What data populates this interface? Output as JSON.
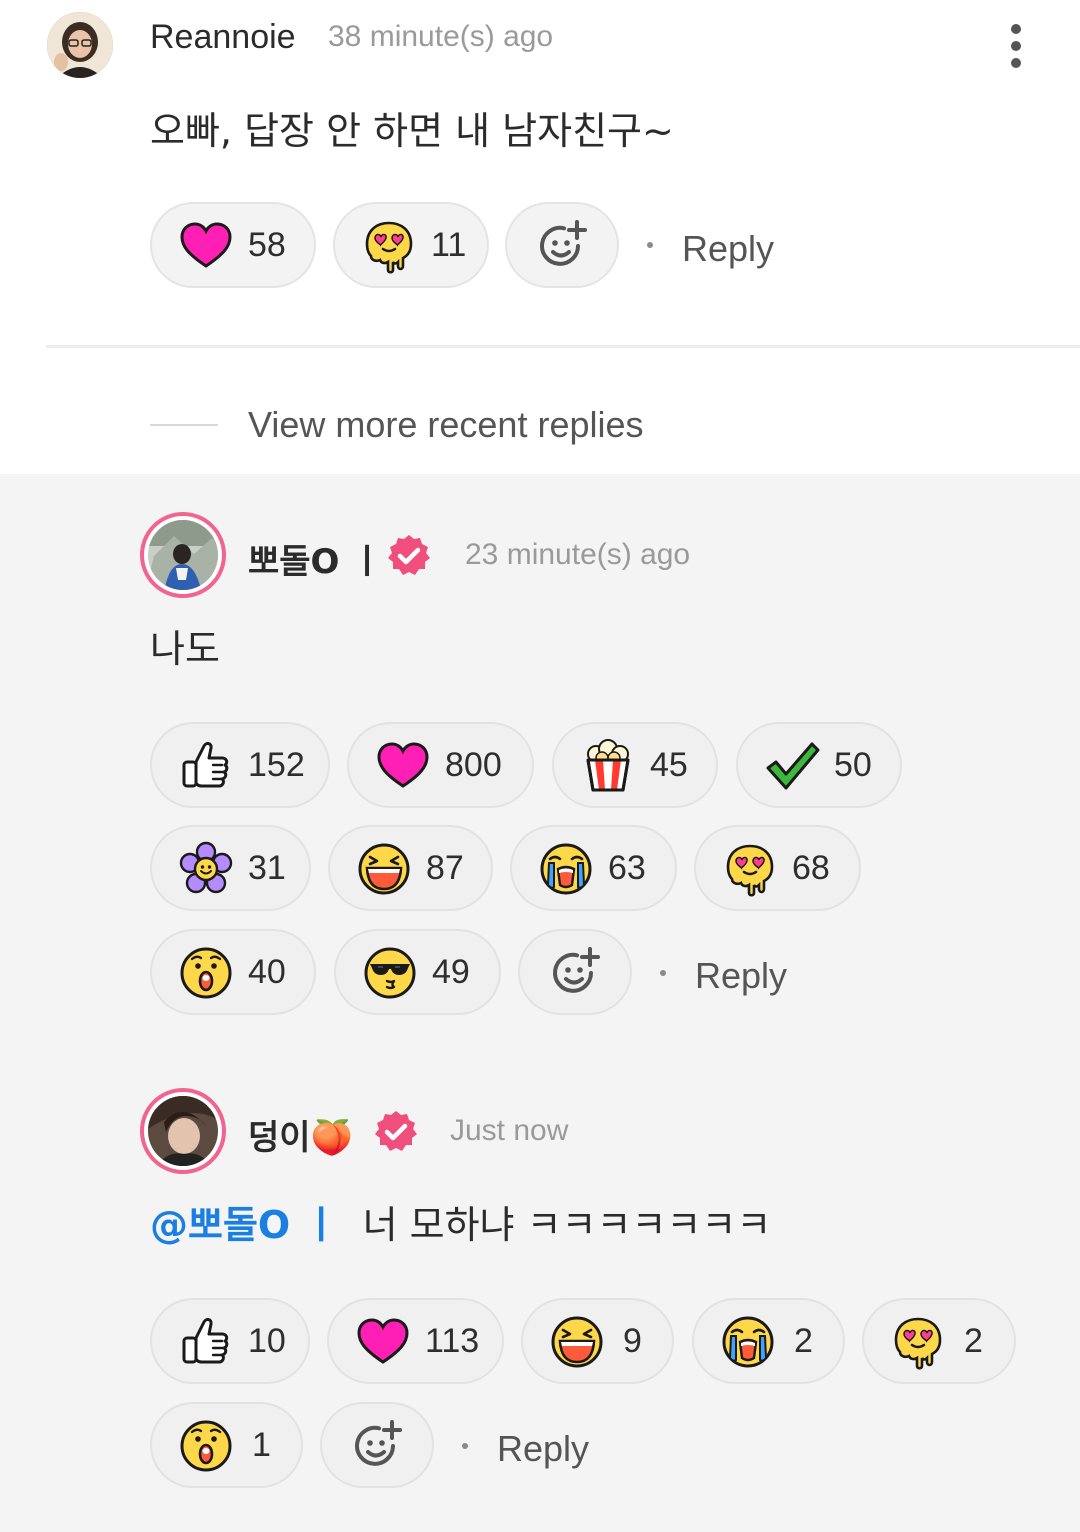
{
  "comment": {
    "username": "Reannoie",
    "timestamp": "38 minute(s) ago",
    "text": "오빠, 답장 안 하면 내 남자친구~",
    "reactions": [
      {
        "icon": "heart-icon",
        "count": "58"
      },
      {
        "icon": "melting-love-face-icon",
        "count": "11"
      }
    ],
    "reply_label": "Reply"
  },
  "view_more_label": "View more recent replies",
  "replies": [
    {
      "username": "뽀돌O ㅣ",
      "timestamp": "23 minute(s) ago",
      "text": "나도",
      "reactions": [
        {
          "icon": "thumbs-up-icon",
          "count": "152"
        },
        {
          "icon": "heart-icon",
          "count": "800"
        },
        {
          "icon": "popcorn-icon",
          "count": "45"
        },
        {
          "icon": "check-mark-icon",
          "count": "50"
        },
        {
          "icon": "flower-icon",
          "count": "31"
        },
        {
          "icon": "laughing-face-icon",
          "count": "87"
        },
        {
          "icon": "crying-face-icon",
          "count": "63"
        },
        {
          "icon": "melting-love-face-icon",
          "count": "68"
        },
        {
          "icon": "surprised-face-icon",
          "count": "40"
        },
        {
          "icon": "sunglasses-face-icon",
          "count": "49"
        }
      ],
      "reply_label": "Reply"
    },
    {
      "username": "덩이🍑",
      "timestamp": "Just now",
      "mention": "@뽀돌O ㅣ",
      "text": "너 모하냐 ㅋㅋㅋㅋㅋㅋㅋ",
      "reactions": [
        {
          "icon": "thumbs-up-icon",
          "count": "10"
        },
        {
          "icon": "heart-icon",
          "count": "113"
        },
        {
          "icon": "laughing-face-icon",
          "count": "9"
        },
        {
          "icon": "crying-face-icon",
          "count": "2"
        },
        {
          "icon": "melting-love-face-icon",
          "count": "2"
        },
        {
          "icon": "surprised-face-icon",
          "count": "1"
        }
      ],
      "reply_label": "Reply"
    }
  ],
  "colors": {
    "accent_pink": "#f0648f",
    "mention_blue": "#1a7fe0",
    "heart_magenta": "#ff1fb4"
  }
}
